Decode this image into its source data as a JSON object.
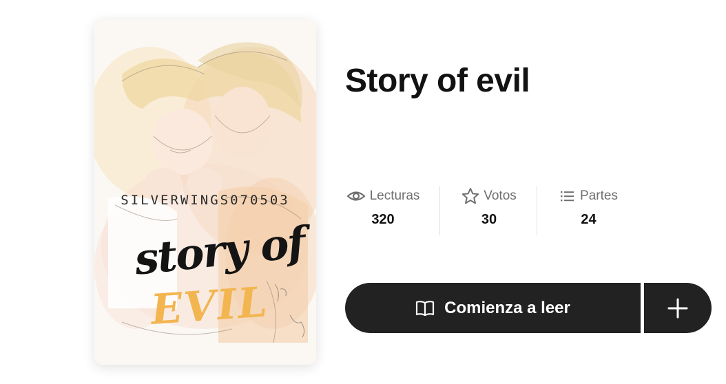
{
  "cover": {
    "author": "SILVERWINGS070503",
    "title_line1": "story of",
    "title_line2": "EVIL",
    "accent_color": "#f2b54f"
  },
  "story": {
    "title": "Story of evil"
  },
  "stats": [
    {
      "icon": "eye-icon",
      "label": "Lecturas",
      "value": "320"
    },
    {
      "icon": "star-icon",
      "label": "Votos",
      "value": "30"
    },
    {
      "icon": "list-icon",
      "label": "Partes",
      "value": "24"
    }
  ],
  "actions": {
    "read_label": "Comienza a leer",
    "read_icon": "book-open-icon",
    "add_icon": "plus-icon",
    "button_color": "#222222"
  }
}
